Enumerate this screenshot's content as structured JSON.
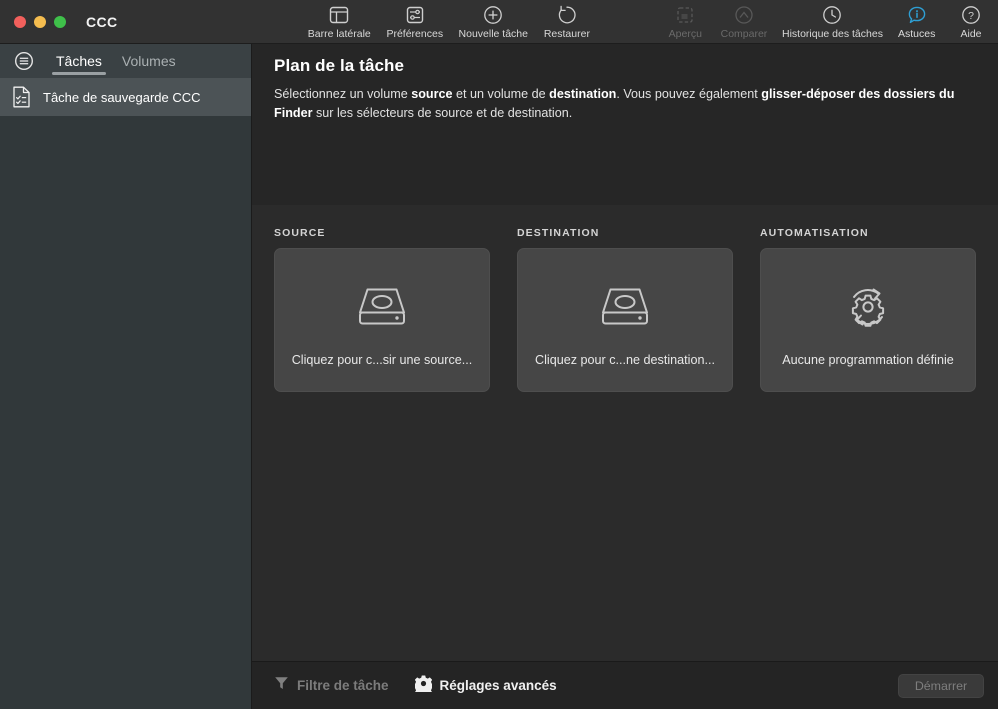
{
  "window": {
    "title": "CCC",
    "traffic_lights": [
      {
        "name": "close",
        "color": "#f2605c"
      },
      {
        "name": "minimize",
        "color": "#f5bd4f"
      },
      {
        "name": "zoom",
        "color": "#3fc04a"
      }
    ]
  },
  "toolbar": {
    "items": [
      {
        "label": "Barre latérale",
        "icon": "sidebar-icon",
        "name": "toolbar-item-sidebar",
        "disabled": false
      },
      {
        "label": "Préférences",
        "icon": "sliders-icon",
        "name": "toolbar-item-preferences",
        "disabled": false
      },
      {
        "label": "Nouvelle tâche",
        "icon": "plus-circle-icon",
        "name": "toolbar-item-new-task",
        "disabled": false
      },
      {
        "label": "Restaurer",
        "icon": "restore-arrow-icon",
        "name": "toolbar-item-restore",
        "disabled": false
      },
      {
        "label": "Aperçu",
        "icon": "preview-icon",
        "name": "toolbar-item-preview",
        "disabled": true
      },
      {
        "label": "Comparer",
        "icon": "compare-icon",
        "name": "toolbar-item-compare",
        "disabled": true
      },
      {
        "label": "Historique des tâches",
        "icon": "clock-icon",
        "name": "toolbar-item-task-history",
        "disabled": false
      },
      {
        "label": "Astuces",
        "icon": "info-bubble-icon",
        "name": "toolbar-item-tips",
        "disabled": false
      },
      {
        "label": "Aide",
        "icon": "question-circle-icon",
        "name": "toolbar-item-help",
        "disabled": false
      }
    ],
    "accent_color": "#2e9fd4"
  },
  "sidebar": {
    "tabs": [
      {
        "label": "Tâches",
        "active": true
      },
      {
        "label": "Volumes",
        "active": false
      }
    ],
    "menu_icon": "hamburger-circle-icon",
    "tasks": [
      {
        "label": "Tâche de sauvegarde CCC",
        "icon": "task-document-icon",
        "selected": true
      }
    ]
  },
  "main": {
    "title": "Plan de la tâche",
    "description": {
      "part1": "Sélectionnez un volume ",
      "strong1": "source",
      "part2": " et un volume de ",
      "strong2": "destination",
      "part3": ". Vous pouvez également ",
      "strong3": "glisser-déposer des dossiers du Finder",
      "part4": " sur les sélecteurs de source et de destination."
    },
    "cards": [
      {
        "section_label": "SOURCE",
        "card_label": "Cliquez pour c...sir une source...",
        "icon": "hard-drive-icon",
        "name": "source-selector"
      },
      {
        "section_label": "DESTINATION",
        "card_label": "Cliquez pour c...ne destination...",
        "icon": "hard-drive-icon",
        "name": "destination-selector"
      },
      {
        "section_label": "AUTOMATISATION",
        "card_label": "Aucune programmation définie",
        "icon": "gear-refresh-icon",
        "name": "automation-selector"
      }
    ]
  },
  "footer": {
    "task_filter": {
      "label": "Filtre de tâche",
      "icon": "funnel-icon",
      "enabled": false
    },
    "advanced_settings": {
      "label": "Réglages avancés",
      "icon": "gear-icon",
      "enabled": true
    },
    "start_button": {
      "label": "Démarrer",
      "enabled": false
    }
  }
}
